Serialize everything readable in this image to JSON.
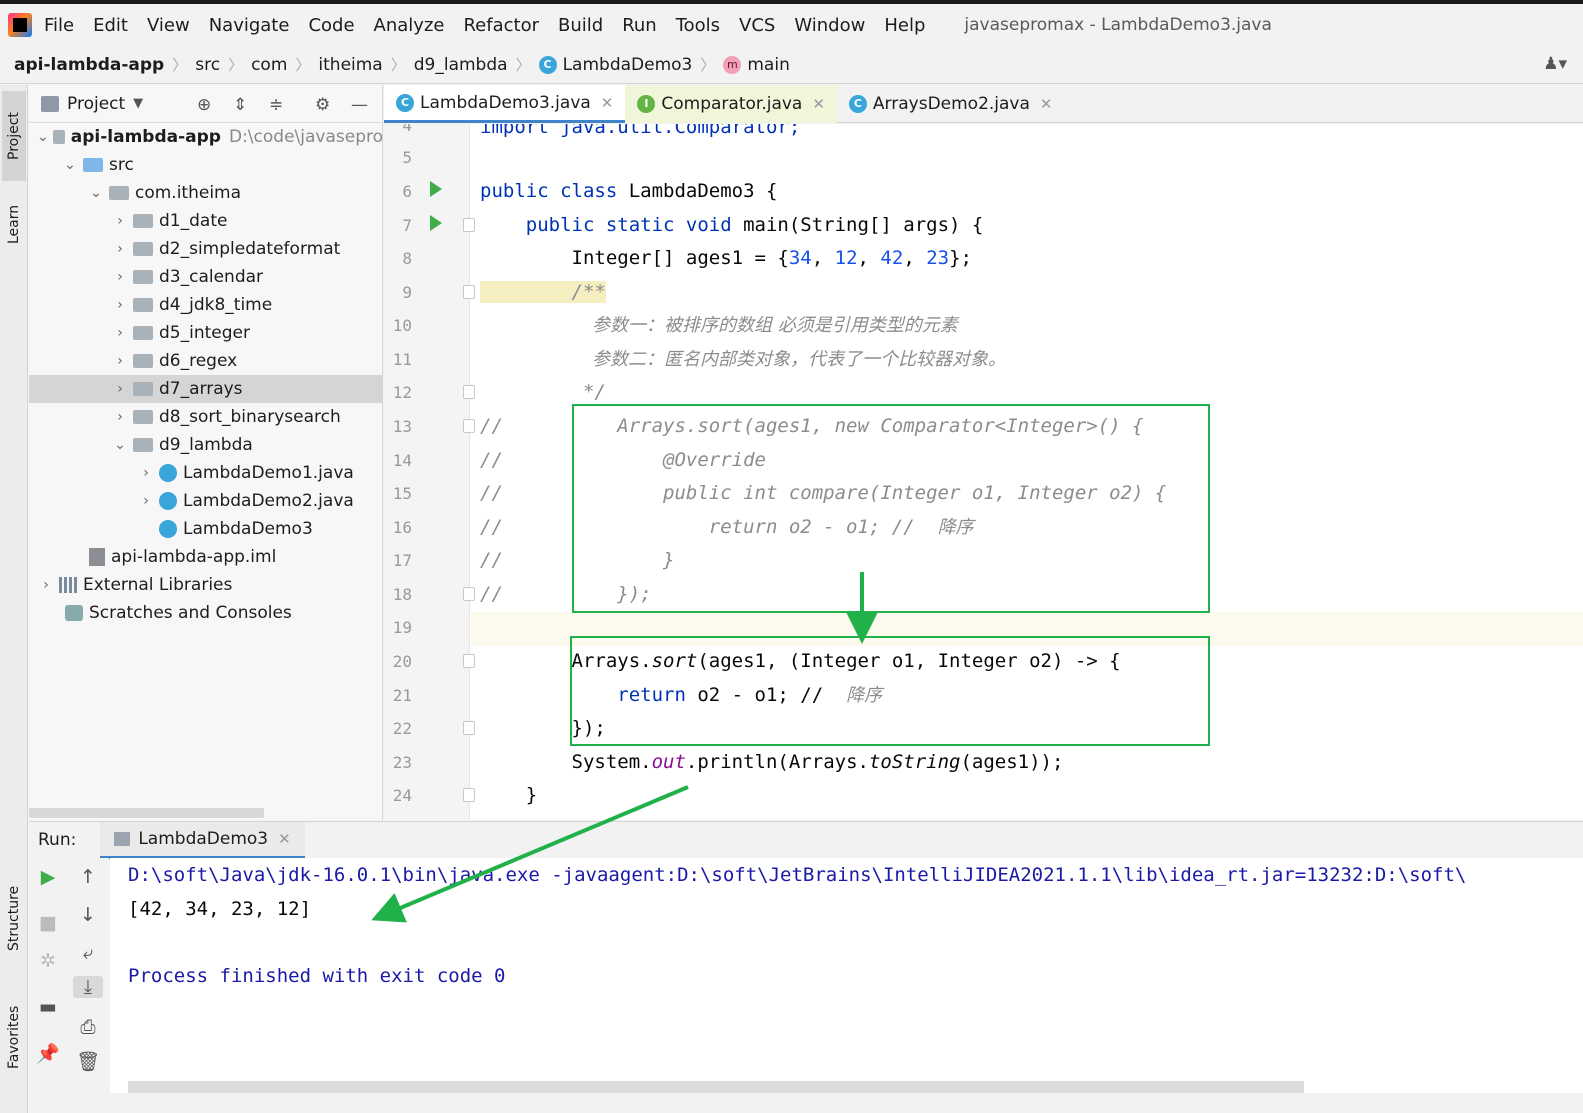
{
  "menu": {
    "items": [
      "File",
      "Edit",
      "View",
      "Navigate",
      "Code",
      "Analyze",
      "Refactor",
      "Build",
      "Run",
      "Tools",
      "VCS",
      "Window",
      "Help"
    ],
    "window_title": "javasepromax - LambdaDemo3.java"
  },
  "navbar": {
    "project": "api-lambda-app",
    "src": "src",
    "com": "com",
    "itheima": "itheima",
    "package": "d9_lambda",
    "class": "LambdaDemo3",
    "method": "main"
  },
  "left_strip": {
    "project": "Project",
    "learn": "Learn",
    "structure": "Structure",
    "favorites": "Favorites"
  },
  "project_panel": {
    "title": "Project",
    "tree": {
      "root": "api-lambda-app",
      "root_path": "D:\\code\\javasepro",
      "src": "src",
      "pkg": "com.itheima",
      "d1": "d1_date",
      "d2": "d2_simpledateformat",
      "d3": "d3_calendar",
      "d4": "d4_jdk8_time",
      "d5": "d5_integer",
      "d6": "d6_regex",
      "d7": "d7_arrays",
      "d8": "d8_sort_binarysearch",
      "d9": "d9_lambda",
      "f1": "LambdaDemo1.java",
      "f2": "LambdaDemo2.java",
      "f3": "LambdaDemo3",
      "iml": "api-lambda-app.iml",
      "ext": "External Libraries",
      "scratch": "Scratches and Consoles"
    }
  },
  "editor_tabs": [
    "LambdaDemo3.java",
    "Comparator.java",
    "ArraysDemo2.java"
  ],
  "editor": {
    "lines": {
      "l4": "import java.util.Comparator;",
      "l6a": "public class ",
      "l6b": "LambdaDemo3 {",
      "l7a": "    public static void ",
      "l7b": "main(String[] args) {",
      "l8a": "        Integer[] ages1 = {",
      "l8n1": "34",
      "l8n2": "12",
      "l8n3": "42",
      "l8n4": "23",
      "l8c": ", ",
      "l8e": "};",
      "l9": "        /**",
      "l10": "参数一：被排序的数组 必须是引用类型的元素",
      "l11": "参数二：匿名内部类对象，代表了一个比较器对象。",
      "l12": "         */",
      "l13": "//          Arrays.sort(ages1, new Comparator<Integer>() {",
      "l14": "//              @Override",
      "l15": "//              public int compare(Integer o1, Integer o2) {",
      "l16a": "//                  return o2 - o1; //  ",
      "l16b": "降序",
      "l17": "//              }",
      "l18": "//          });",
      "l20a": "        Arrays.",
      "l20b": "sort",
      "l20c": "(ages1, (Integer o1, Integer o2) -> {",
      "l21a": "            ",
      "l21b": "return",
      "l21c": " o2 - o1; //  ",
      "l21d": "降序",
      "l22": "        });",
      "l23a": "        System.",
      "l23b": "out",
      "l23c": ".println(Arrays.",
      "l23d": "toString",
      "l23e": "(ages1));",
      "l24": "    }"
    }
  },
  "run_panel": {
    "label": "Run:",
    "tab": "LambdaDemo3",
    "console": {
      "cmd": "D:\\soft\\Java\\jdk-16.0.1\\bin\\java.exe -javaagent:D:\\soft\\JetBrains\\IntelliJIDEA2021.1.1\\lib\\idea_rt.jar=13232:D:\\soft\\",
      "output": "[42, 34, 23, 12]",
      "finished": "Process finished with exit code 0"
    }
  },
  "colors": {
    "keyword": "#0033b3",
    "number": "#1750eb",
    "comment": "#8c8c8c",
    "annotation_green": "#21b14b",
    "accent": "#4083c9"
  }
}
